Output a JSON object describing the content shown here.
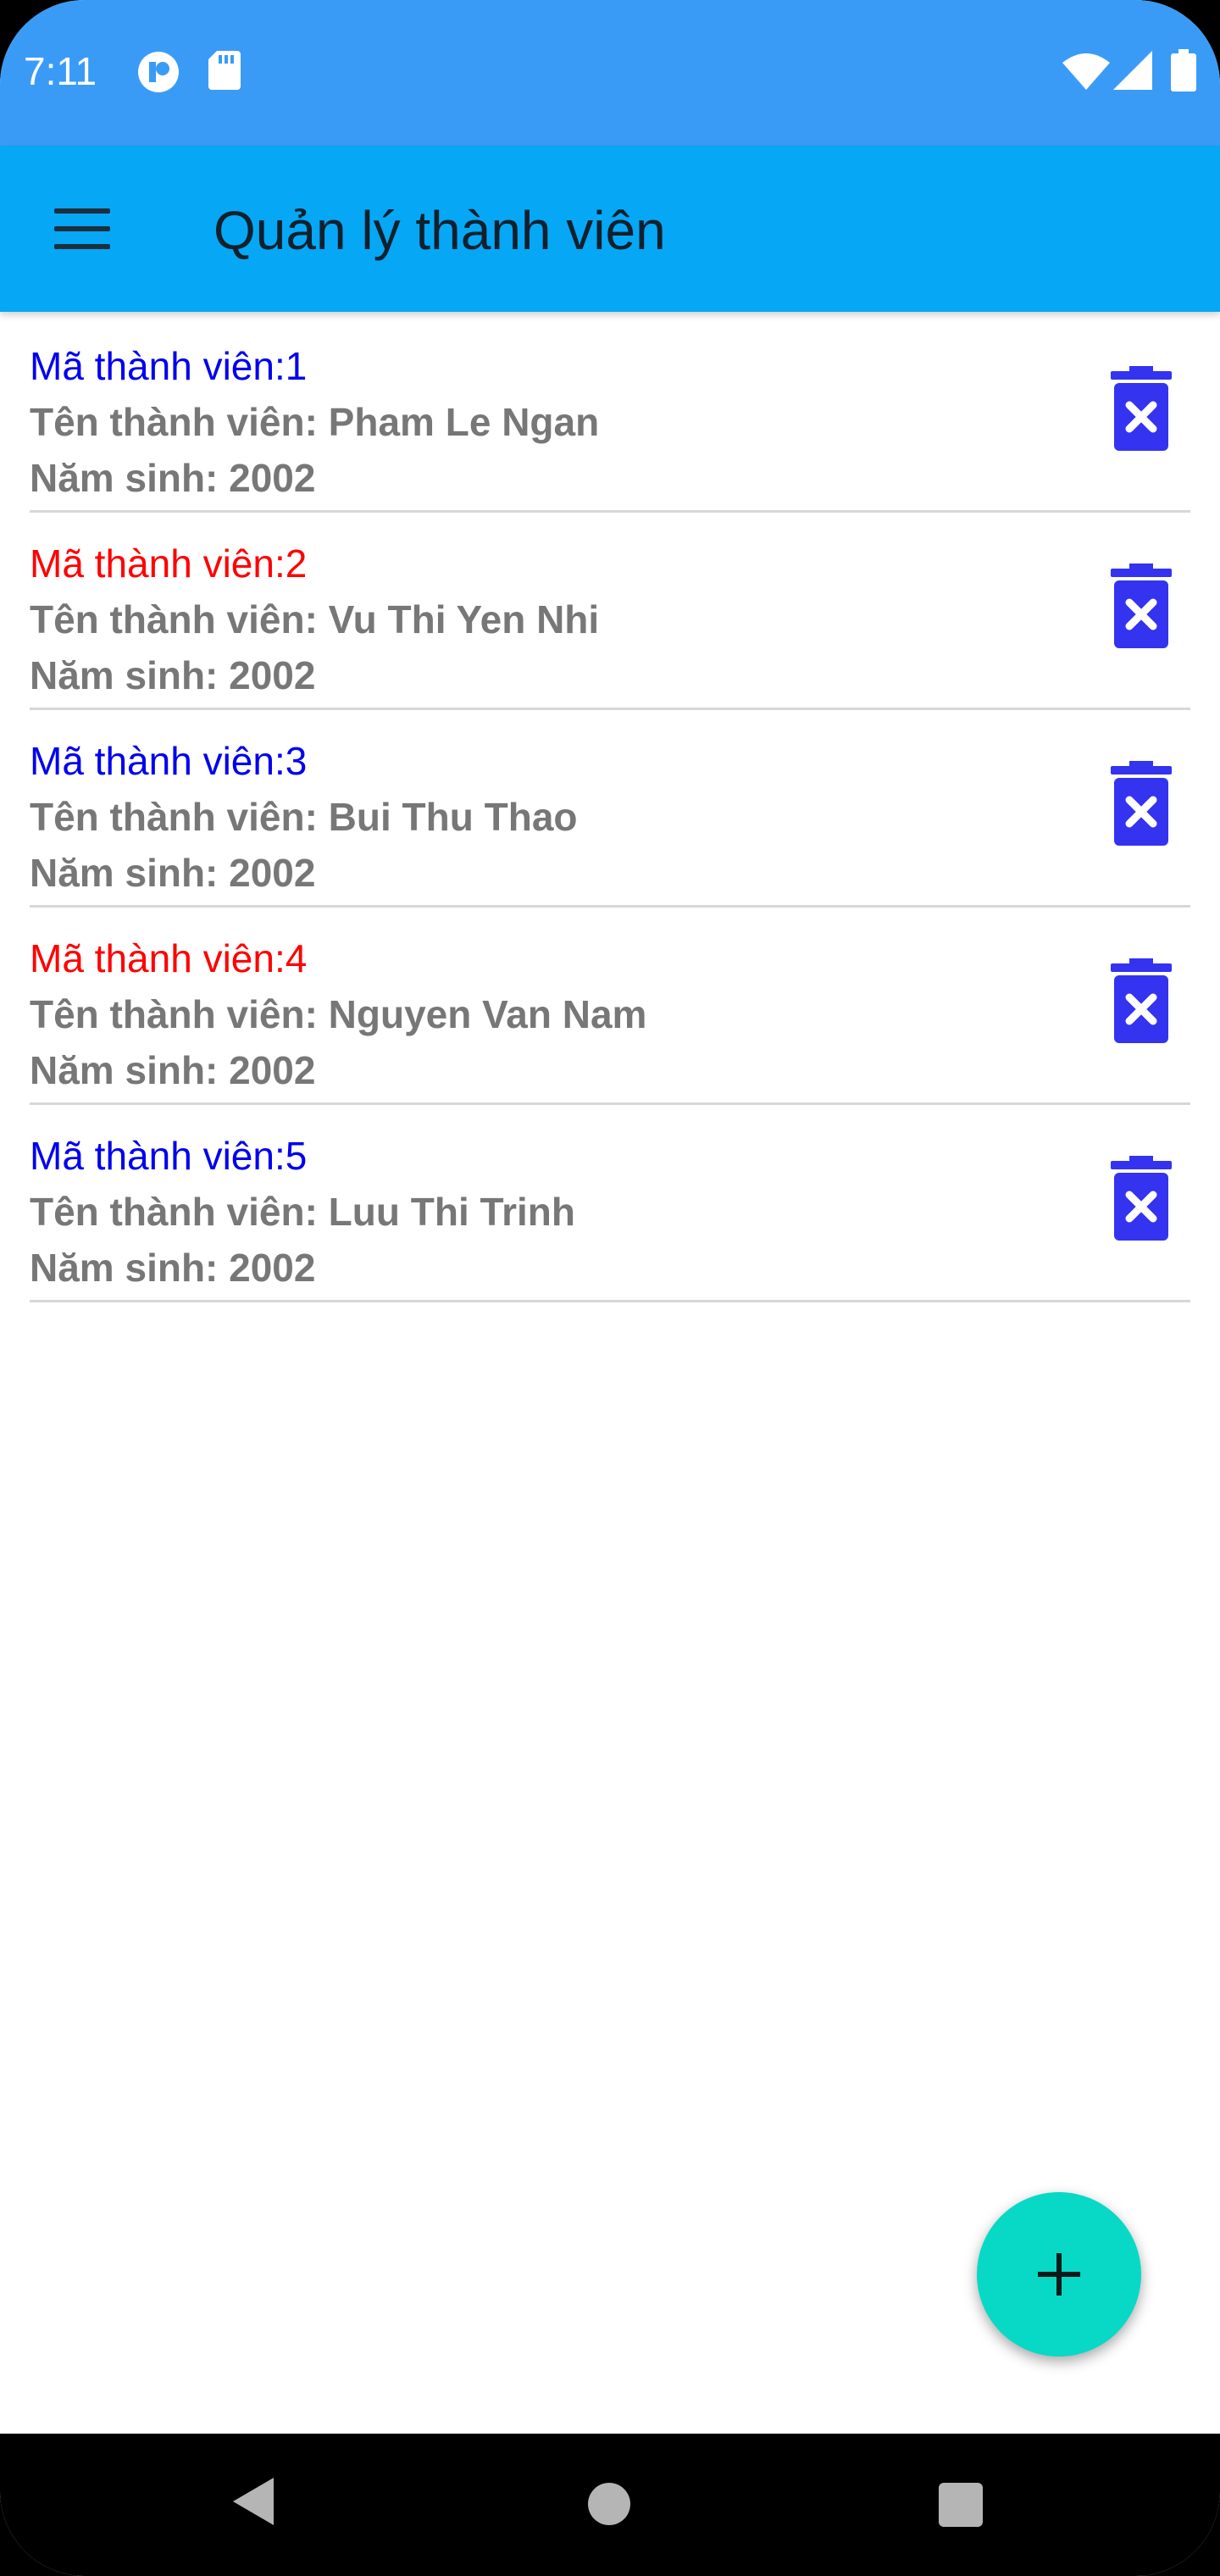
{
  "status_bar": {
    "time": "7:11",
    "icons_left": [
      "app-notification-icon",
      "sd-card-icon"
    ],
    "icons_right": [
      "wifi-icon",
      "signal-icon",
      "battery-icon"
    ]
  },
  "app_bar": {
    "title": "Quản lý thành viên",
    "menu_icon": "menu-icon"
  },
  "colors": {
    "status_bar": "#3a9bf7",
    "app_bar": "#06a7f5",
    "id_odd": "#0000ee",
    "id_even": "#ff0000",
    "delete_icon": "#3433f0",
    "fab": "#07d9c6",
    "text_gray": "#777777"
  },
  "members": [
    {
      "id_label": "Mã thành viên:1",
      "name_label": "Tên thành viên: Pham Le Ngan",
      "year_label": "Năm sinh: 2002",
      "id_color": "#0000ee"
    },
    {
      "id_label": "Mã thành viên:2",
      "name_label": "Tên thành viên: Vu Thi Yen Nhi",
      "year_label": "Năm sinh: 2002",
      "id_color": "#ff0000"
    },
    {
      "id_label": "Mã thành viên:3",
      "name_label": "Tên thành viên: Bui Thu Thao",
      "year_label": "Năm sinh: 2002",
      "id_color": "#0000ee"
    },
    {
      "id_label": "Mã thành viên:4",
      "name_label": "Tên thành viên: Nguyen Van Nam",
      "year_label": "Năm sinh: 2002",
      "id_color": "#ff0000"
    },
    {
      "id_label": "Mã thành viên:5",
      "name_label": "Tên thành viên: Luu Thi Trinh",
      "year_label": "Năm sinh: 2002",
      "id_color": "#0000ee"
    }
  ],
  "fab": {
    "icon": "plus-icon"
  },
  "nav_bar": {
    "icons": [
      "back-icon",
      "home-icon",
      "recents-icon"
    ]
  }
}
